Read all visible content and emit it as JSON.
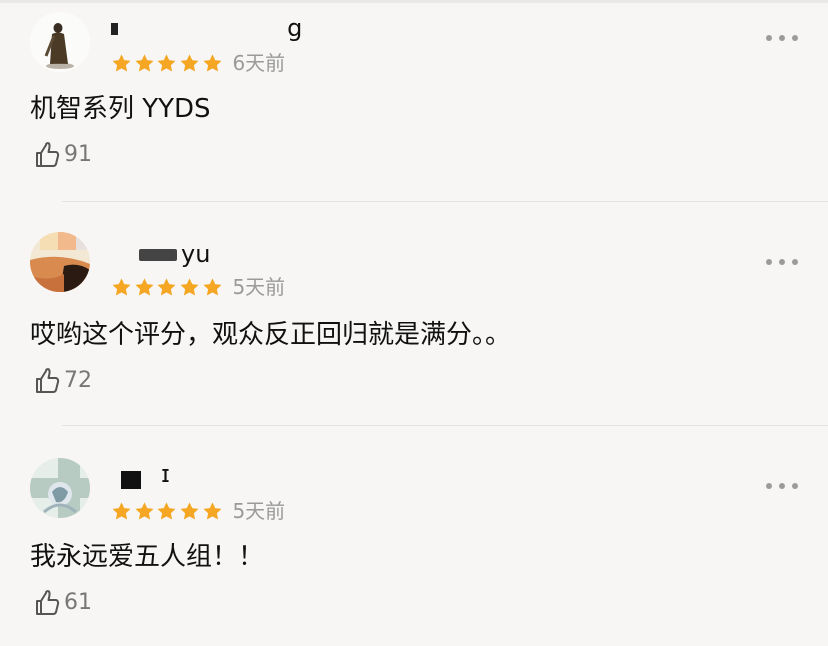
{
  "comments": [
    {
      "username": "         g",
      "rating": 5,
      "time": "6天前",
      "content": "机智系列 YYDS",
      "likes": "91"
    },
    {
      "username": "yu",
      "rating": 5,
      "time": "5天前",
      "content": "哎哟这个评分，观众反正回归就是满分。。",
      "likes": "72"
    },
    {
      "username": "ɪ",
      "rating": 5,
      "time": "5天前",
      "content": "我永远爱五人组！！",
      "likes": "61"
    }
  ],
  "icons": {
    "star": "star-icon",
    "more": "more-dots-icon",
    "like": "thumbs-up-icon"
  },
  "colors": {
    "star": "#f5a623",
    "background": "#f7f6f4",
    "meta_text": "#9a9a9a",
    "divider": "#e4e3e1"
  }
}
